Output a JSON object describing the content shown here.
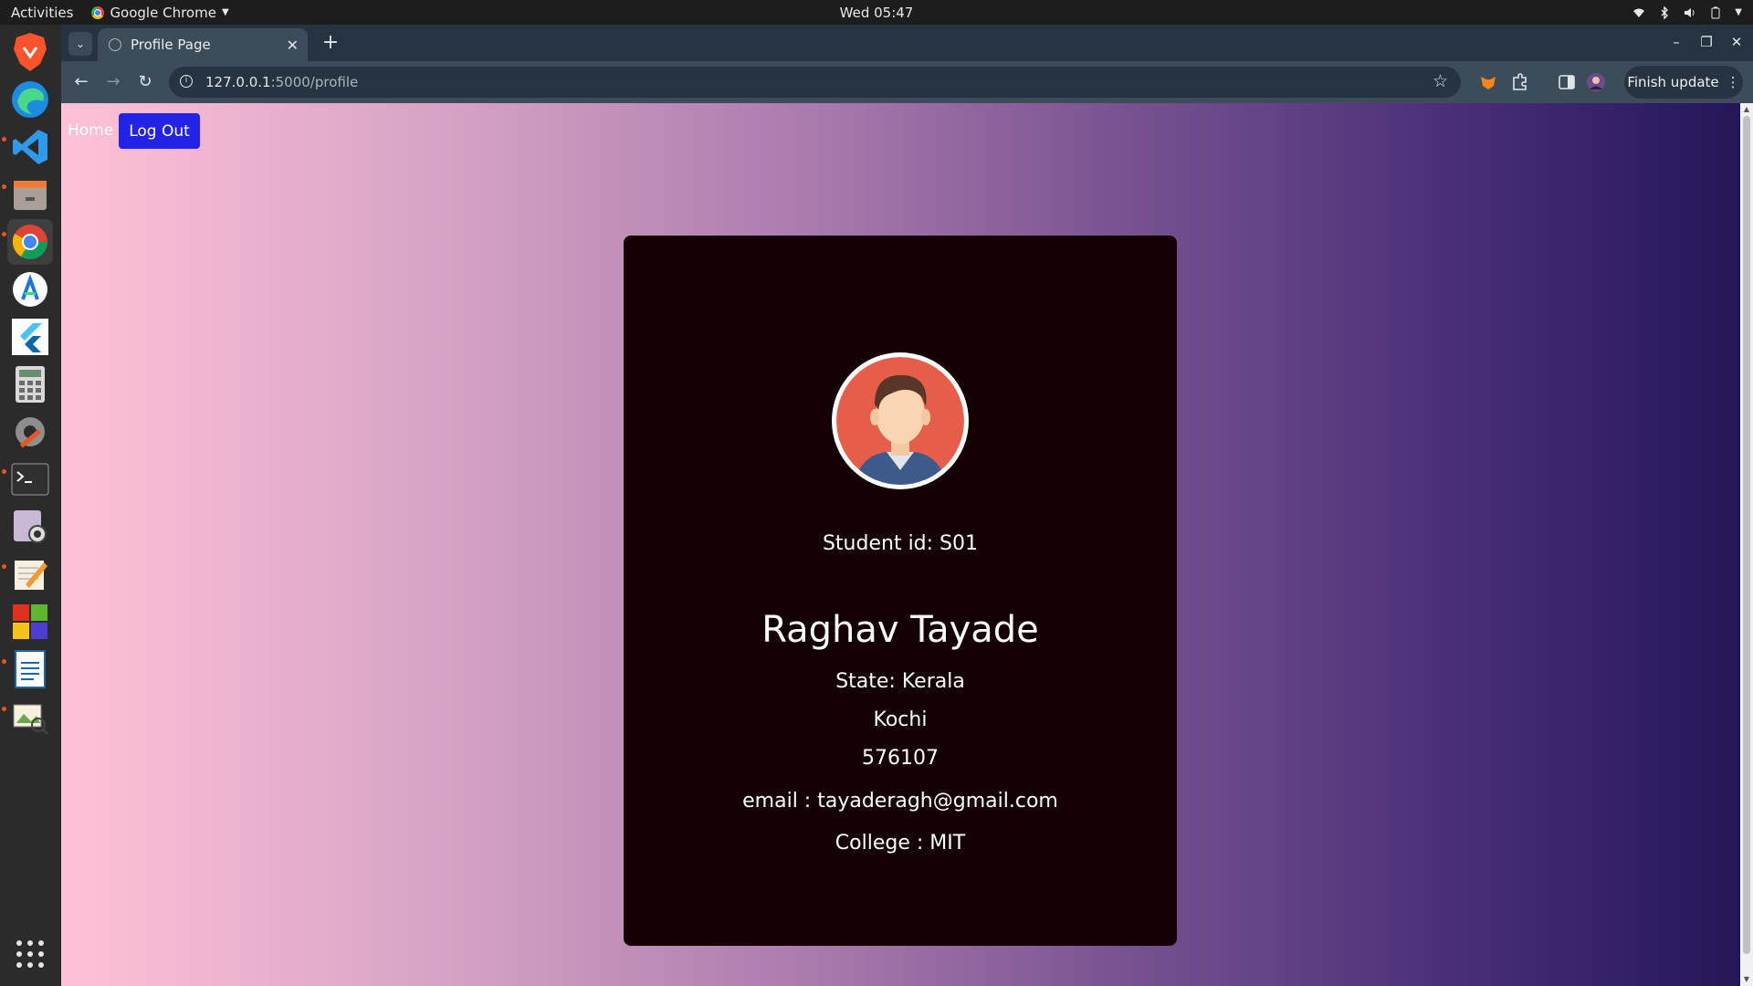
{
  "topbar": {
    "activities": "Activities",
    "app_name": "Google Chrome",
    "clock": "Wed 05:47"
  },
  "browser": {
    "tab_title": "Profile Page",
    "url_host": "127.0.0.1",
    "url_path": ":5000/profile",
    "finish_update_label": "Finish update"
  },
  "dock": {
    "apps": [
      "brave",
      "edge",
      "vscode",
      "files",
      "chrome",
      "android-studio",
      "flutter",
      "calculator",
      "settings",
      "terminal",
      "screenshot",
      "text-editor",
      "vlc-like",
      "writer",
      "image-viewer",
      "app-grid"
    ]
  },
  "nav": {
    "home_label": "Home",
    "logout_label": "Log Out"
  },
  "profile": {
    "student_id": "Student id: S01",
    "name": "Raghav Tayade",
    "state": "State: Kerala",
    "city": "Kochi",
    "pincode": "576107",
    "email": "email : tayaderagh@gmail.com",
    "college": "College : MIT"
  },
  "colors": {
    "card_bg": "#140104",
    "logout_bg": "#2323e8",
    "gradient_start": "#ffc1d8",
    "gradient_end": "#231557",
    "avatar_bg": "#e65e4a"
  }
}
